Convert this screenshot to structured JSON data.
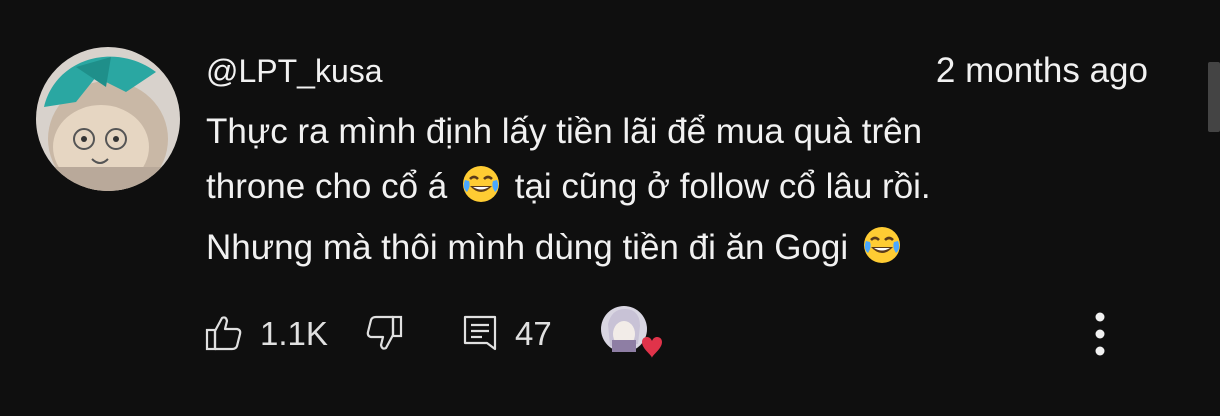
{
  "comment": {
    "author": "@LPT_kusa",
    "timestamp": "2 months ago",
    "lines": [
      {
        "before": "Thực ra mình định lấy tiền lãi để mua quà trên",
        "after": ""
      },
      {
        "before": "throne cho cổ á ",
        "after": " tại cũng ở follow cổ lâu rồi."
      },
      {
        "before": "Nhưng mà thôi mình dùng tiền đi ăn Gogi ",
        "after": ""
      }
    ],
    "emoji": "face-with-tears-of-joy-icon"
  },
  "actions": {
    "like_count": "1.1K",
    "reply_count": "47",
    "like_icon": "thumbs-up-icon",
    "dislike_icon": "thumbs-down-icon",
    "reply_icon": "comment-icon",
    "heart_icon": "creator-heart-icon",
    "menu_icon": "more-vert-icon"
  },
  "colors": {
    "background": "#0f0f0f",
    "text": "#f1f1f1",
    "heart": "#e0334a",
    "avatar_hair": "#2aa7a2"
  }
}
